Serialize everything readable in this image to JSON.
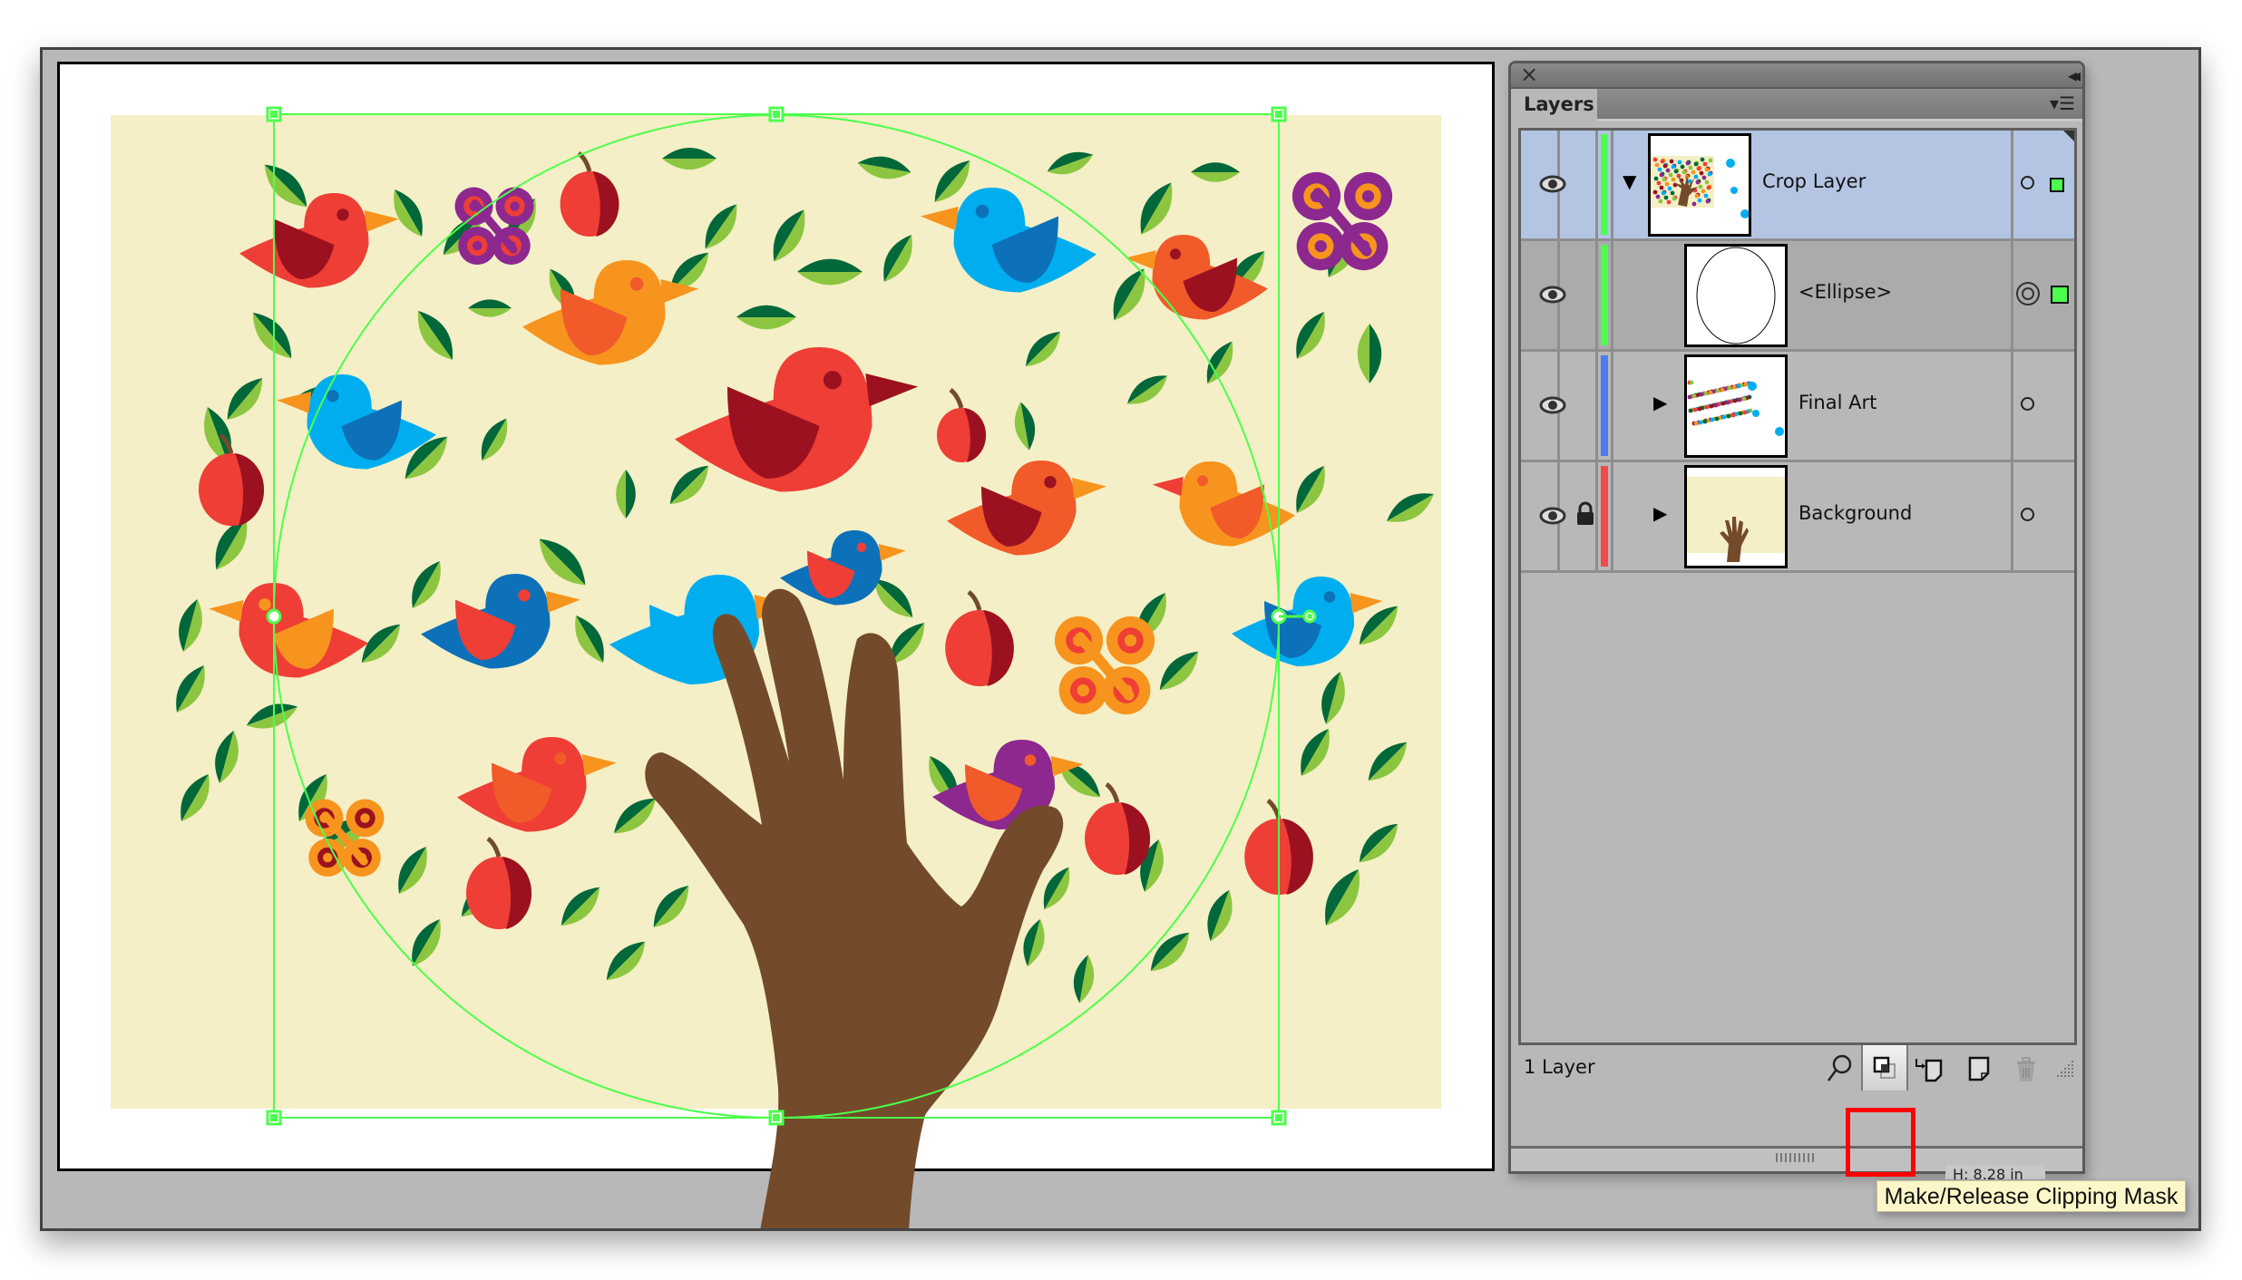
{
  "canvas": {
    "artwork": "tree-hand-birds-illustration",
    "colors": {
      "background_beige": "#f4efc6",
      "hand_brown": "#734b2a",
      "selection_green": "#4cff4c",
      "leaf_dark": "#02683a",
      "leaf_light": "#8cc640",
      "red": "#ef3e36",
      "dark_red": "#9c1120",
      "orange": "#f7941e",
      "blue": "#00aeef",
      "dark_blue": "#0d71b9",
      "purple": "#8d288f"
    }
  },
  "layers_panel": {
    "close_icon": "close-icon",
    "collapse_icon": "double-chevron-left-icon",
    "tab_label": "Layers",
    "menu_icon": "panel-menu-icon",
    "rows": [
      {
        "name": "Crop Layer",
        "visible": true,
        "locked": false,
        "expanded": true,
        "color": "#4cff4c",
        "selected": true,
        "target": "circle",
        "has_selection": true,
        "indent": 0
      },
      {
        "name": "<Ellipse>",
        "visible": true,
        "locked": false,
        "expanded": null,
        "color": "#4cff4c",
        "selected": false,
        "target": "double-circle",
        "has_selection": true,
        "indent": 1
      },
      {
        "name": "Final Art",
        "visible": true,
        "locked": false,
        "expanded": false,
        "color": "#4a7cf2",
        "selected": false,
        "target": "circle",
        "has_selection": false,
        "indent": 1
      },
      {
        "name": "Background",
        "visible": true,
        "locked": true,
        "expanded": false,
        "color": "#f24a4a",
        "selected": false,
        "target": "circle",
        "has_selection": false,
        "indent": 1
      }
    ],
    "footer": {
      "layer_count": "1 Layer",
      "buttons": [
        {
          "name": "locate-object",
          "icon": "search-icon"
        },
        {
          "name": "make-release-clipping-mask",
          "icon": "clipping-mask-icon",
          "highlighted": true
        },
        {
          "name": "create-new-sublayer",
          "icon": "new-sublayer-icon"
        },
        {
          "name": "create-new-layer",
          "icon": "new-layer-icon"
        },
        {
          "name": "delete-selection",
          "icon": "trash-icon",
          "disabled": true
        }
      ]
    }
  },
  "tooltip": {
    "text": "Make/Release Clipping Mask"
  },
  "obscured_readout": "H: 8.28 in"
}
